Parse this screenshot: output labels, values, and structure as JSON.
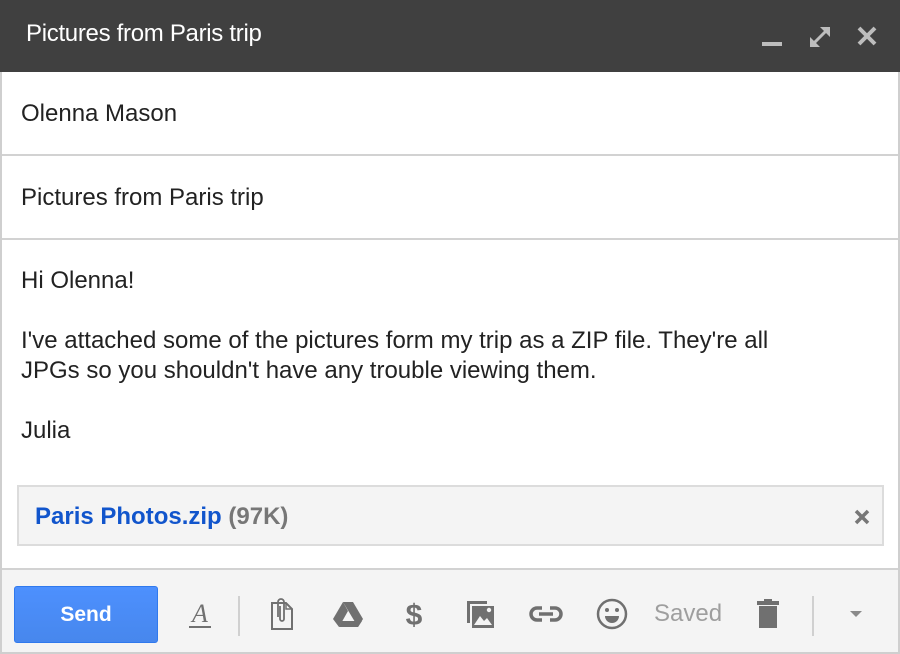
{
  "window": {
    "title": "Pictures from Paris trip",
    "controls": [
      {
        "name": "minimize",
        "icon": "minimize-icon"
      },
      {
        "name": "pop-out",
        "icon": "expand-icon"
      },
      {
        "name": "close",
        "icon": "close-icon"
      }
    ]
  },
  "compose": {
    "to": "Olenna Mason",
    "subject": "Pictures from Paris trip",
    "body": {
      "greeting": "Hi Olenna!",
      "line1": "I've attached some of the pictures form my trip as a ZIP file. They're all",
      "line2": "JPGs so you shouldn't have any trouble viewing them.",
      "signature": "Julia"
    },
    "attachment": {
      "filename": "Paris Photos.zip",
      "size": "(97K)"
    }
  },
  "toolbar": {
    "send_label": "Send",
    "status": "Saved",
    "tools": [
      "formatting-icon",
      "attach-file-icon",
      "drive-icon",
      "money-icon",
      "photo-icon",
      "link-icon",
      "emoji-icon",
      "trash-icon",
      "more-options-icon"
    ]
  },
  "colors": {
    "titlebar": "#404040",
    "send": "#4d90fe",
    "link": "#1155cc",
    "icon": "#707070"
  }
}
